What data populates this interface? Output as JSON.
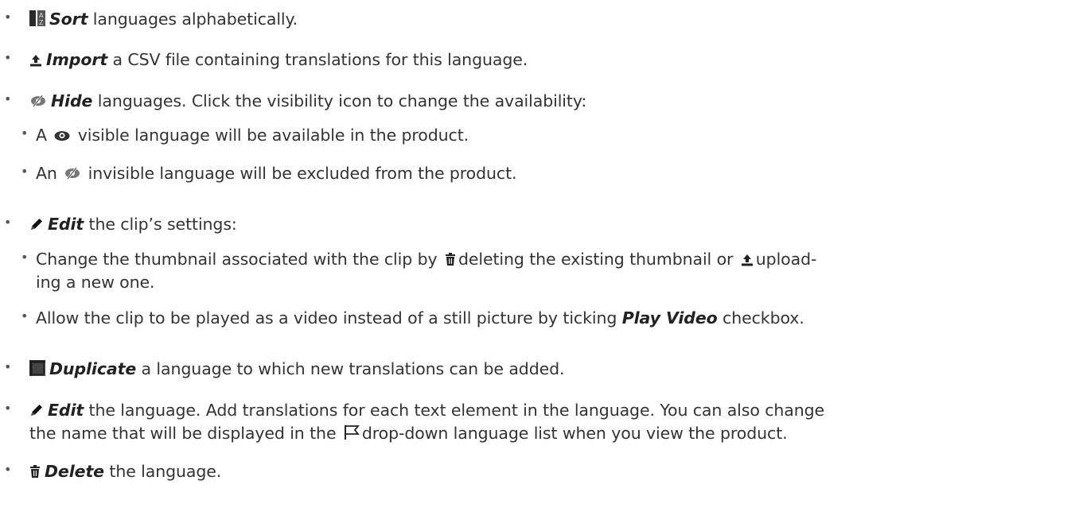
{
  "items": [
    {
      "emph": "Sort",
      "text": " languages alphabetically.",
      "icon": "sort-icon"
    },
    {
      "emph": "Import",
      "text": " a CSV file containing translations for this language.",
      "icon": "upload-icon"
    },
    {
      "emph": "Hide",
      "text": " languages. Click the visibility icon to change the availability:",
      "icon": "eye-slash-icon"
    },
    {
      "pre": "A",
      "text": " visible language will be available in the product.",
      "icon": "eye-icon"
    },
    {
      "pre": "An",
      "text": " invisible language will be excluded from the product.",
      "icon": "eye-slash-icon"
    },
    {
      "emph": "Edit",
      "text": " the clip’s settings:",
      "icon": "pencil-icon"
    },
    {
      "a": "Change the thumbnail associated with the clip by",
      "b": "deleting the existing thumbnail or",
      "c": "upload-",
      "d": "ing a new one.",
      "icon1": "trash-icon",
      "icon2": "upload-icon"
    },
    {
      "pre": "Allow the clip to be played as a video instead of a still picture by ticking ",
      "emph": "Play Video",
      "text": " checkbox."
    },
    {
      "emph": "Duplicate",
      "text": " a language to which new translations can be added.",
      "icon": "duplicate-icon"
    },
    {
      "emph": "Edit",
      "text": " the language. Add translations for each text element in the language. You can also change",
      "cont_pre": "the name that will be displayed in the",
      "cont_post": "drop-down language list when you view the product.",
      "icon": "pencil-icon",
      "icon2": "flag-icon"
    },
    {
      "emph": "Delete",
      "text": " the language.",
      "icon": "trash-icon"
    }
  ]
}
